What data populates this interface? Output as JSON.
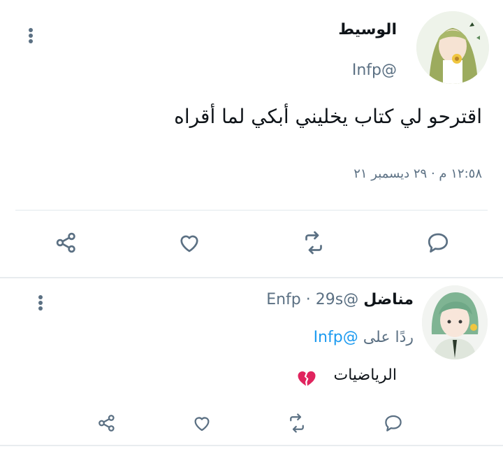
{
  "tweet": {
    "author_name": "الوسيط",
    "author_handle": "Infp@",
    "text": "اقترحو لي كتاب يخليني أبكي لما أقراه",
    "timestamp": "١٢:٥٨ م · ٢٩ ديسمبر ٢١",
    "actions": [
      "reply-icon",
      "retweet-icon",
      "like-icon",
      "share-icon"
    ]
  },
  "reply": {
    "author_name": "مناضل",
    "author_handle": "@Enfp",
    "time": "29s",
    "separator": "·",
    "replying_to_label": "ردًا على",
    "replying_to_handle": "@Infp",
    "text": "الرياضيات",
    "emoji": "broken-heart-icon",
    "actions": [
      "reply-icon",
      "retweet-icon",
      "like-icon",
      "share-icon"
    ]
  },
  "colors": {
    "text": "#0f1419",
    "secondary": "#5b7083",
    "link": "#1d9bf0",
    "divider": "#e1e8ed",
    "heart_red": "#e0245e"
  }
}
